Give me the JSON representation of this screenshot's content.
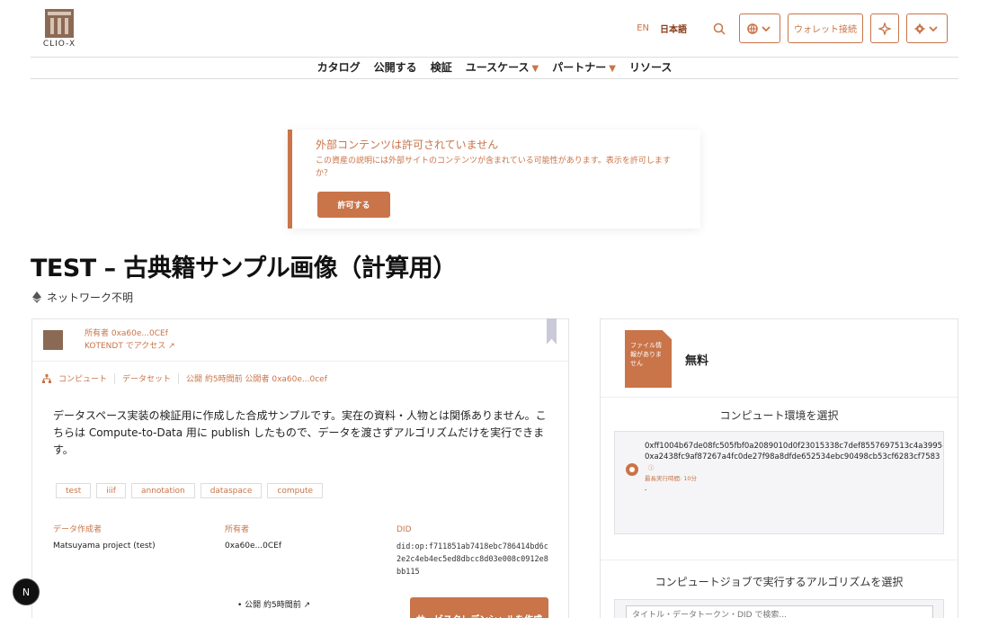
{
  "header": {
    "logo_text": "CLIO-X",
    "lang_en": "EN",
    "lang_ja": "日本語",
    "wallet_label": "ウォレット接続"
  },
  "nav": {
    "items": [
      {
        "label": "カタログ",
        "dropdown": false
      },
      {
        "label": "公開する",
        "dropdown": false
      },
      {
        "label": "検証",
        "dropdown": false
      },
      {
        "label": "ユースケース",
        "dropdown": true
      },
      {
        "label": "パートナー",
        "dropdown": true
      },
      {
        "label": "リソース",
        "dropdown": false
      }
    ]
  },
  "warning": {
    "title": "外部コンテンツは許可されていません",
    "text": "この資産の説明には外部サイトのコンテンツが含まれている可能性があります。表示を許可しますか？",
    "button": "許可する"
  },
  "asset": {
    "title": "TEST – 古典籍サンプル画像（計算用）",
    "network": "ネットワーク不明",
    "owner_line": "所有者 0xa60e...0CEf",
    "access_line": "KOTENDT でアクセス ↗",
    "type_compute": "コンピュート",
    "type_dataset": "データセット",
    "published_meta": "公開 約5時間前 公開者 0xa60e...0cef",
    "description": "データスペース実装の検証用に作成した合成サンプルです。実在の資料・人物とは関係ありません。こちらは Compute-to-Data 用に publish したもので、データを渡さずアルゴリズムだけを実行できます。",
    "tags": [
      "test",
      "iiif",
      "annotation",
      "dataspace",
      "compute"
    ],
    "creator_label": "データ作成者",
    "creator_value": "Matsuyama project (test)",
    "owner_label": "所有者",
    "owner_value": "0xa60e...0CEf",
    "did_label": "DID",
    "did_value": "did:op:f711851ab7418ebc786414bd6c2e2c4eb4ec5ed8dbcc8d03e008c0912e8bb115",
    "published_bullet": "公開 約5時間前 ↗",
    "service_button": "サービスクレデンシャルを作成"
  },
  "sidebar": {
    "file_badge": "ファイル情報がありません",
    "price": "無料",
    "env_title": "コンピュート環境を選択",
    "env_line1": "0xff1004b67de08fc505fbf0a2089010d0f23015338c7def8557697513c4a3995-",
    "env_line2": "0xa2438fc9af87267a4fc0de27f98a8dfde652534ebc90498cb53cf6283cf7583",
    "env_meta": "最長実行時間: 10分",
    "env_dash": "-",
    "algo_title": "コンピュートジョブで実行するアルゴリズムを選択",
    "algo_placeholder": "タイトル・データトークン・DID で検索..."
  },
  "misc": {
    "n_badge": "N"
  },
  "colors": {
    "accent": "#c97449",
    "accent_dark": "#8a3d1a"
  }
}
